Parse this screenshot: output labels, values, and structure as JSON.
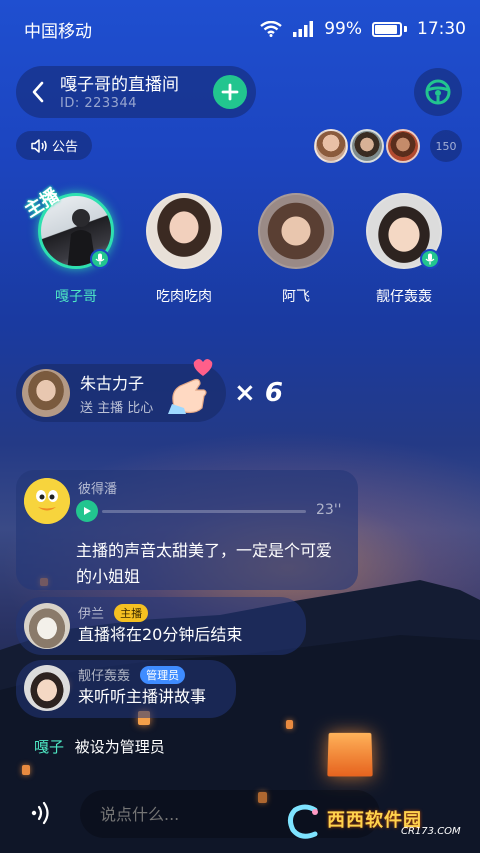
{
  "status_bar": {
    "carrier": "中国移动",
    "battery": "99%",
    "time": "17:30"
  },
  "room": {
    "title": "嘎子哥的直播间",
    "id_label": "ID: 223344",
    "notice_label": "公告",
    "audience_count": "150"
  },
  "seats": [
    {
      "name": "嘎子哥",
      "role": "host"
    },
    {
      "name": "吃肉吃肉"
    },
    {
      "name": "阿飞"
    },
    {
      "name": "靓仔轰轰"
    }
  ],
  "host_badge": "主播",
  "gift": {
    "sender": "朱古力子",
    "description": "送 主播 比心",
    "multiplier": "× 6"
  },
  "messages": [
    {
      "name": "彼得潘",
      "voice_duration": "23''",
      "text": "主播的声音太甜美了，一定是个可爱的小姐姐"
    },
    {
      "name": "伊兰",
      "tag": "主播",
      "text": "直播将在20分钟后结束"
    },
    {
      "name": "靓仔轰轰",
      "tag": "管理员",
      "text": "来听听主播讲故事"
    }
  ],
  "system_message": {
    "user": "嘎子",
    "text": "被设为管理员"
  },
  "input": {
    "placeholder": "说点什么..."
  },
  "watermark": {
    "brand": "西西软件园",
    "url": "CR173.COM"
  },
  "colors": {
    "accent_green": "#22c58f",
    "host_name": "#4ee8c4",
    "host_tag": "#f5c021",
    "admin_tag": "#3f8cff"
  }
}
